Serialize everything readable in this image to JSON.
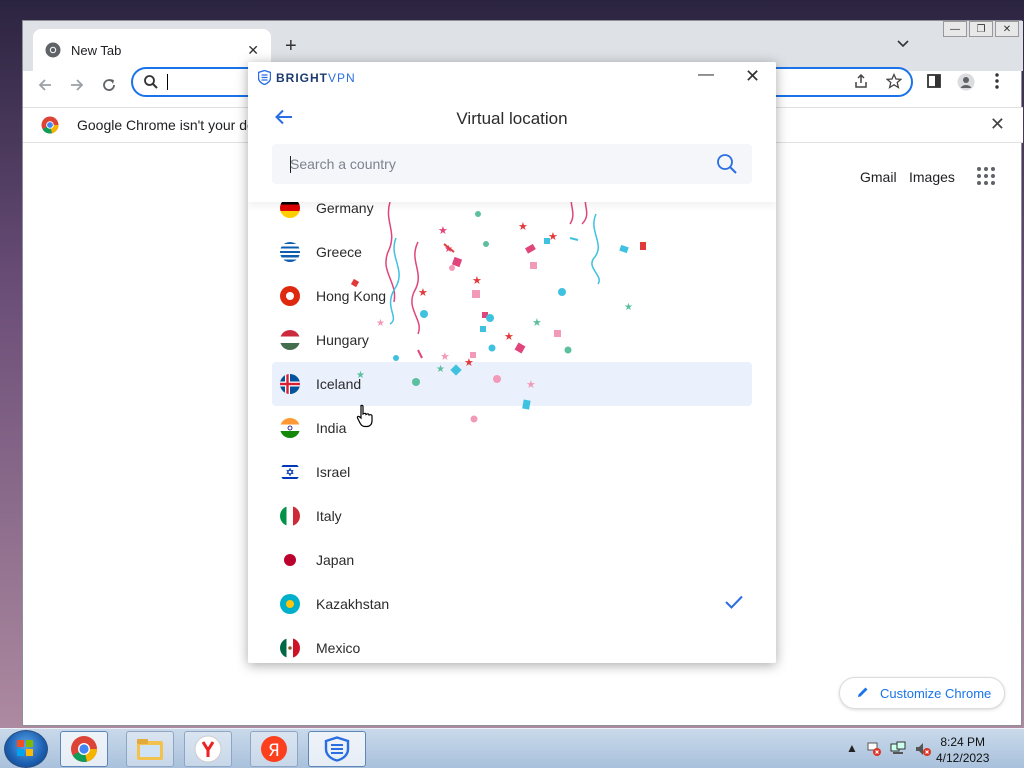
{
  "browser": {
    "tab_title": "New Tab",
    "tab_close": "✕",
    "new_tab": "+",
    "tab_list": "⌄",
    "infobar_text": "Google Chrome isn't your de",
    "infobar_close": "✕",
    "gmail": "Gmail",
    "images": "Images",
    "customize_label": "Customize Chrome",
    "window_controls": [
      "—",
      "❐",
      "✕"
    ]
  },
  "vpn": {
    "brand_bright": "BRIGHT",
    "brand_vpn": "VPN",
    "minimize": "—",
    "close": "✕",
    "title": "Virtual location",
    "search_placeholder": "Search a country",
    "selected_country": "Kazakhstan",
    "hovered_country": "Iceland",
    "countries": [
      {
        "name": "Germany"
      },
      {
        "name": "Greece"
      },
      {
        "name": "Hong Kong"
      },
      {
        "name": "Hungary"
      },
      {
        "name": "Iceland"
      },
      {
        "name": "India"
      },
      {
        "name": "Israel"
      },
      {
        "name": "Italy"
      },
      {
        "name": "Japan"
      },
      {
        "name": "Kazakhstan"
      },
      {
        "name": "Mexico"
      }
    ]
  },
  "taskbar": {
    "time": "8:24 PM",
    "date": "4/12/2023"
  },
  "colors": {
    "accent": "#1a73e8",
    "vpn_blue": "#2b6ee4",
    "highlight": "#eaf1fd"
  }
}
